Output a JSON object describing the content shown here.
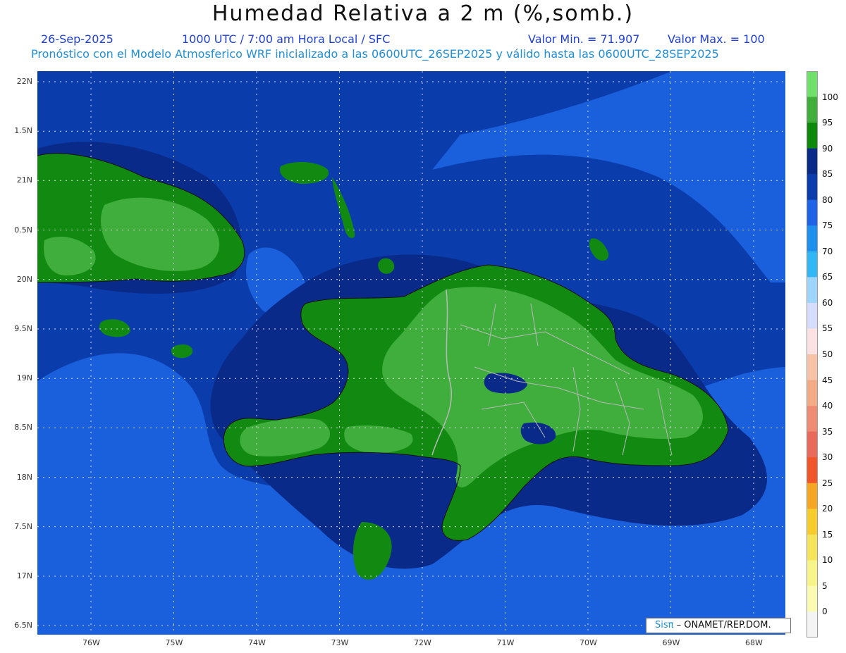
{
  "header": {
    "title": "Humedad Relativa a 2 m (%,somb.)",
    "date": "26-Sep-2025",
    "time": "1000 UTC / 7:00 am Hora Local / SFC",
    "min_value": "Valor Min. = 71.907",
    "max_value": "Valor Max. = 100",
    "model_info": "Pronóstico con el Modelo Atmosferico WRF inicializado a las 0600UTC_26SEP2025 y válido hasta las 0600UTC_28SEP2025"
  },
  "map": {
    "lat_labels": [
      "22N",
      "1.5N",
      "21N",
      "0.5N",
      "20N",
      "9.5N",
      "19N",
      "8.5N",
      "18N",
      "7.5N",
      "17N",
      "6.5N"
    ],
    "lon_labels": [
      "76W",
      "75W",
      "74W",
      "73W",
      "72W",
      "71W",
      "70W",
      "69W",
      "68W"
    ],
    "colors": {
      "sea_shallow": "#1a5fdc",
      "sea_deep": "#0a3dab",
      "humid_80": "#0a3dab",
      "humid_85": "#0a2a8a",
      "land_high": "#3fae3c",
      "land_mid": "#128a12",
      "coastline": "#111111",
      "border": "#b8b8b8"
    }
  },
  "colorbar": {
    "labels": [
      "100",
      "95",
      "90",
      "85",
      "80",
      "75",
      "70",
      "65",
      "60",
      "55",
      "50",
      "45",
      "40",
      "35",
      "30",
      "25",
      "20",
      "15",
      "10",
      "5",
      "0"
    ],
    "colors": [
      "#6fe06a",
      "#3fae3c",
      "#0d8a0d",
      "#0a2a8a",
      "#0a3dab",
      "#1f63e6",
      "#1f8fee",
      "#32b6f5",
      "#9fd4fb",
      "#d6dcfb",
      "#fbe1e1",
      "#f6c3a6",
      "#f3aa86",
      "#ef8b74",
      "#e86a5a",
      "#f2552a",
      "#f5a623",
      "#f7cc2c",
      "#f5e35c",
      "#f7f58a",
      "#fbfbb4",
      "#f4f4f4"
    ]
  },
  "credit": {
    "logo": "Sisπ",
    "org": "– ONAMET/REP.DOM."
  }
}
